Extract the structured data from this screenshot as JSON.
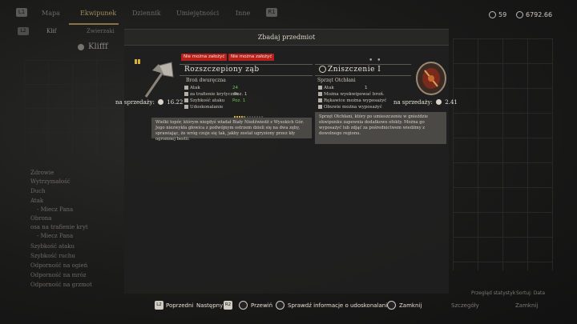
{
  "top_tabs": {
    "l1": "L1",
    "r1": "R1",
    "items": [
      "Mapa",
      "Ekwipunek",
      "Dziennik",
      "Umiejętności",
      "Inne"
    ]
  },
  "currency": {
    "skill_points": "59",
    "gold": "6792.66"
  },
  "sub_tabs": {
    "l2": "L2",
    "items": [
      "Klif",
      "Zwierzaki"
    ]
  },
  "left_title": "Klifff",
  "dialog": {
    "title": "Zbadaj przedmiot",
    "dots": "• •"
  },
  "item_left": {
    "tags": [
      "Nie można założyć",
      "Nie można założyć"
    ],
    "name": "Rozszczepiony ząb",
    "type": "Broń dwuręczna",
    "stats": [
      {
        "label": "Atak",
        "value": "24"
      },
      {
        "label": "za trafienie krytyczne",
        "value": "Poz. 1"
      },
      {
        "label": "Szybkość ataku",
        "value": "Poz. 1"
      },
      {
        "label": "Udoskonalanie",
        "value": ""
      }
    ],
    "upgrade_progress": 0.36,
    "price_label": "na sprzedaży:",
    "price": "16.22",
    "description": "Wielki topór, którym niegdyś władał Biały Niedźwiedź z Wysokich Gór. Jego niezwykła głowica z podwójnym ostrzem dzieli się na dwa zęby, sprawiając, że wróg czuje się tak, jakby został ugryziony przez kły ogromnej bestii."
  },
  "item_right": {
    "name": "Zniszczenie I",
    "type": "Sprzęt Otchłani",
    "stats": [
      {
        "label": "Atak",
        "value": "1"
      },
      {
        "label": "Można wyekwipować broń.",
        "value": ""
      },
      {
        "label": "Rękawice można wyposażyć",
        "value": ""
      },
      {
        "label": "Obuwie można wyposażyć",
        "value": ""
      }
    ],
    "price_label": "na sprzedaży:",
    "price": "2.41",
    "description": "Sprzęt Otchłani, który po umieszczeniu w gnieździe ekwipunku zapewnia dodatkowe efekty. Można go wyposażyć lub zdjąć za pośrednictwem wiedźmy z dowolnego regionu."
  },
  "bg_stats": [
    "Zdrowie",
    "Wytrzymałość",
    "Duch",
    "Atak",
    "- Miecz Pana",
    "Obrona",
    "osa na trafienie kryt",
    "- Miecz Pana",
    "Szybkość ataku",
    "Szybkość ruchu",
    "Odporność na ogień",
    "Odporność na mróz",
    "Odporność na grzmot"
  ],
  "bottom": {
    "prev_key": "L2",
    "prev": "Poprzedni",
    "next": "Następny",
    "next_key": "R2",
    "scroll": "Przewiń",
    "info": "Sprawdź informacje o udoskonalaniu",
    "close": "Zamknij",
    "bg_hint_1": "Szczegóły",
    "bg_hint_2": "Zamknij",
    "bg_hint_3": "Sortuj: Data",
    "bg_hint_4": "Przegląd statystyk"
  }
}
